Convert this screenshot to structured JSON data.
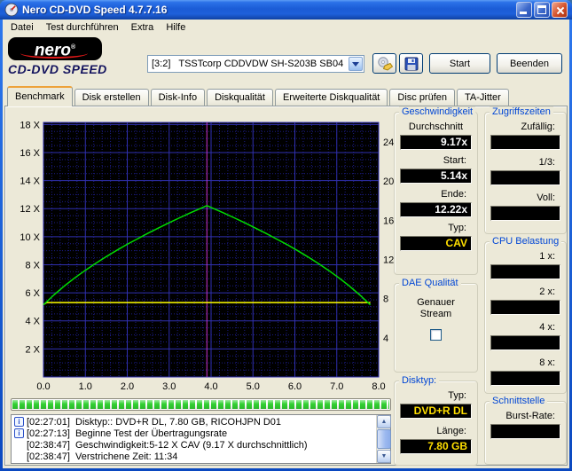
{
  "window": {
    "title": "Nero CD-DVD Speed 4.7.7.16"
  },
  "menu": {
    "items": [
      "Datei",
      "Test durchführen",
      "Extra",
      "Hilfe"
    ]
  },
  "logo": {
    "brand": "nero",
    "registered": "®",
    "product": "CD-DVD SPEED"
  },
  "toolbar": {
    "drive_selector": "[3:2]   TSSTcorp CDDVDW SH-S203B SB04",
    "start_label": "Start",
    "quit_label": "Beenden"
  },
  "tabs": [
    {
      "label": "Benchmark",
      "active": true
    },
    {
      "label": "Disk erstellen",
      "active": false
    },
    {
      "label": "Disk-Info",
      "active": false
    },
    {
      "label": "Diskqualität",
      "active": false
    },
    {
      "label": "Erweiterte Diskqualität",
      "active": false
    },
    {
      "label": "Disc prüfen",
      "active": false
    },
    {
      "label": "TA-Jitter",
      "active": false
    }
  ],
  "colors": {
    "lcd_white": "#ffffff",
    "lcd_yellow": "#ffdf00",
    "lcd_background": "#000000"
  },
  "panels": {
    "speed": {
      "title": "Geschwindigkeit",
      "rows": [
        {
          "label": "Durchschnitt",
          "value": "9.17x",
          "color": "white",
          "center": true
        },
        {
          "label": "Start:",
          "value": "5.14x",
          "color": "white"
        },
        {
          "label": "Ende:",
          "value": "12.22x",
          "color": "white"
        },
        {
          "label": "Typ:",
          "value": "CAV",
          "color": "yellow"
        }
      ]
    },
    "dae": {
      "title": "DAE Qualität",
      "label": "Genauer Stream",
      "checkbox_checked": false
    },
    "disc": {
      "title": "Disktyp:",
      "rows": [
        {
          "label": "Typ:",
          "value": "DVD+R DL",
          "color": "yellow"
        },
        {
          "label": "Länge:",
          "value": "7.80 GB",
          "color": "yellow"
        }
      ]
    },
    "access": {
      "title": "Zugriffszeiten",
      "rows": [
        {
          "label": "Zufällig:",
          "value": "",
          "color": "white"
        },
        {
          "label": "1/3:",
          "value": "",
          "color": "white"
        },
        {
          "label": "Voll:",
          "value": "",
          "color": "white"
        }
      ]
    },
    "cpu": {
      "title": "CPU Belastung",
      "rows": [
        {
          "label": "1 x:",
          "value": "",
          "color": "white"
        },
        {
          "label": "2 x:",
          "value": "",
          "color": "white"
        },
        {
          "label": "4 x:",
          "value": "",
          "color": "white"
        },
        {
          "label": "8 x:",
          "value": "",
          "color": "white"
        }
      ]
    },
    "interface": {
      "title": "Schnittstelle",
      "rows": [
        {
          "label": "Burst-Rate:",
          "value": "",
          "color": "white"
        }
      ]
    }
  },
  "progress": {
    "percent": 100
  },
  "log": {
    "lines": [
      {
        "icon": true,
        "text": "[02:27:01]  Disktyp:: DVD+R DL, 7.80 GB, RICOHJPN D01"
      },
      {
        "icon": true,
        "text": "[02:27:13]  Beginne Test der Übertragungsrate"
      },
      {
        "icon": false,
        "text": "[02:38:47]  Geschwindigkeit:5-12 X CAV (9.17 X durchschnittlich)"
      },
      {
        "icon": false,
        "text": "[02:38:47]  Verstrichene Zeit: 11:34"
      }
    ]
  },
  "chart_data": {
    "type": "line",
    "title": "",
    "xlabel": "",
    "plot_bg": "#000000",
    "grid_color": "#1c1c86",
    "grid_major_color": "#3030b0",
    "x_axis": {
      "min": 0,
      "max": 8,
      "minor_step": 0.2,
      "major_step": 1,
      "ticks": [
        {
          "v": 0,
          "label": "0.0"
        },
        {
          "v": 1,
          "label": "1.0"
        },
        {
          "v": 2,
          "label": "2.0"
        },
        {
          "v": 3,
          "label": "3.0"
        },
        {
          "v": 4,
          "label": "4.0"
        },
        {
          "v": 5,
          "label": "5.0"
        },
        {
          "v": 6,
          "label": "6.0"
        },
        {
          "v": 7,
          "label": "7.0"
        },
        {
          "v": 8,
          "label": "8.0"
        }
      ]
    },
    "y_left": {
      "min": 0,
      "max": 18.15,
      "minor_step": 0.5,
      "major_step": 2,
      "ticks": [
        {
          "v": 2,
          "label": "2 X"
        },
        {
          "v": 4,
          "label": "4 X"
        },
        {
          "v": 6,
          "label": "6 X"
        },
        {
          "v": 8,
          "label": "8 X"
        },
        {
          "v": 10,
          "label": "10 X"
        },
        {
          "v": 12,
          "label": "12 X"
        },
        {
          "v": 14,
          "label": "14 X"
        },
        {
          "v": 16,
          "label": "16 X"
        },
        {
          "v": 18,
          "label": "18 X"
        }
      ]
    },
    "y_right": {
      "min": 0,
      "max": 26,
      "ticks": [
        {
          "v": 4,
          "label": "4"
        },
        {
          "v": 8,
          "label": "8"
        },
        {
          "v": 12,
          "label": "12"
        },
        {
          "v": 16,
          "label": "16"
        },
        {
          "v": 20,
          "label": "20"
        },
        {
          "v": 24,
          "label": "24"
        }
      ]
    },
    "markers": [
      {
        "type": "vline",
        "x": 3.9,
        "color": "#cc33cc",
        "name": "layer-break"
      }
    ],
    "series": [
      {
        "name": "read-speed",
        "axis": "left",
        "color": "#00dc00",
        "points": [
          [
            0,
            5.14
          ],
          [
            0.25,
            5.85
          ],
          [
            0.5,
            6.49
          ],
          [
            0.75,
            7.07
          ],
          [
            1,
            7.61
          ],
          [
            1.25,
            8.11
          ],
          [
            1.5,
            8.58
          ],
          [
            1.75,
            9.03
          ],
          [
            2,
            9.46
          ],
          [
            2.25,
            9.86
          ],
          [
            2.5,
            10.26
          ],
          [
            2.75,
            10.63
          ],
          [
            3,
            11.0
          ],
          [
            3.25,
            11.35
          ],
          [
            3.5,
            11.69
          ],
          [
            3.75,
            12.02
          ],
          [
            3.9,
            12.22
          ],
          [
            4.05,
            12.02
          ],
          [
            4.3,
            11.69
          ],
          [
            4.55,
            11.35
          ],
          [
            4.8,
            11.0
          ],
          [
            5.05,
            10.63
          ],
          [
            5.3,
            10.26
          ],
          [
            5.55,
            9.86
          ],
          [
            5.8,
            9.46
          ],
          [
            6.05,
            9.03
          ],
          [
            6.3,
            8.58
          ],
          [
            6.55,
            8.11
          ],
          [
            6.8,
            7.61
          ],
          [
            7.05,
            7.07
          ],
          [
            7.3,
            6.49
          ],
          [
            7.55,
            5.85
          ],
          [
            7.8,
            5.14
          ]
        ]
      },
      {
        "name": "rotation-speed",
        "axis": "right",
        "color": "#ffff00",
        "points": [
          [
            0,
            7.4
          ],
          [
            0.08,
            7.6
          ],
          [
            3.88,
            7.6
          ],
          [
            3.94,
            7.6
          ],
          [
            7.8,
            7.6
          ]
        ]
      }
    ]
  }
}
